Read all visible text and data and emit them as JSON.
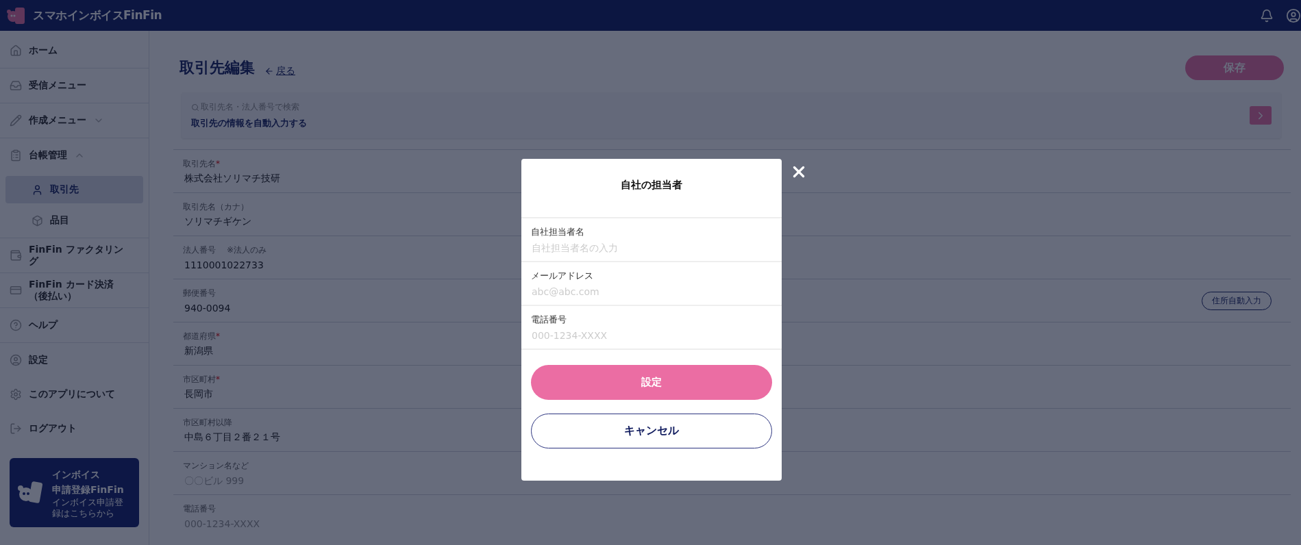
{
  "header": {
    "logo_text": "スマホインボイスFinFin"
  },
  "sidebar": {
    "items": [
      {
        "label": "ホーム",
        "selected": false
      },
      {
        "label": "受信メニュー",
        "selected": false
      },
      {
        "label": "作成メニュー",
        "selected": false,
        "expanded": false
      },
      {
        "label": "台帳管理",
        "selected": false,
        "expanded": true,
        "children": [
          {
            "label": "取引先",
            "selected": true
          },
          {
            "label": "品目",
            "selected": false
          }
        ]
      },
      {
        "label": "FinFin ファクタリング",
        "selected": false
      },
      {
        "label": "FinFin カード決済（後払い）",
        "selected": false
      },
      {
        "label": "ヘルプ",
        "selected": false
      },
      {
        "label": "設定",
        "selected": false
      },
      {
        "label": "このアプリについて",
        "selected": false
      },
      {
        "label": "ログアウト",
        "selected": false
      }
    ],
    "banner": {
      "title_lines": [
        "インボイス",
        "申請登録FinFin"
      ],
      "description": "インボイス申請登録はこちらから"
    }
  },
  "page": {
    "title": "取引先編集",
    "back_link": "戻る",
    "save_button": "保存",
    "search": {
      "placeholder": "取引先名・法人番号で検索",
      "link": "取引先の情報を自動入力する"
    },
    "fields": [
      {
        "label": "取引先名",
        "required_mark": "*",
        "value": "株式会社ソリマチ技研"
      },
      {
        "label": "取引先名（カナ）",
        "value": "ソリマチギケン"
      },
      {
        "label": "法人番号",
        "note": "※法人のみ",
        "value": "1110001022733"
      },
      {
        "label": "郵便番号",
        "value": "940-0094",
        "action": "住所自動入力"
      },
      {
        "label": "都道府県",
        "required_mark": "*",
        "value": "新潟県"
      },
      {
        "label": "市区町村",
        "required_mark": "*",
        "value": "長岡市"
      },
      {
        "label": "市区町村以降",
        "value": "中島６丁目２番２１号"
      },
      {
        "label": "マンション名など",
        "placeholder": "〇〇ビル 999"
      },
      {
        "label": "電話番号",
        "placeholder": "000-1234-XXXX"
      }
    ]
  },
  "modal": {
    "title": "自社の担当者",
    "fields": [
      {
        "label": "自社担当者名",
        "placeholder": "自社担当者名の入力"
      },
      {
        "label": "メールアドレス",
        "placeholder": "abc@abc.com"
      },
      {
        "label": "電話番号",
        "placeholder": "000-1234-XXXX"
      }
    ],
    "confirm_button": "設定",
    "cancel_button": "キャンセル"
  }
}
